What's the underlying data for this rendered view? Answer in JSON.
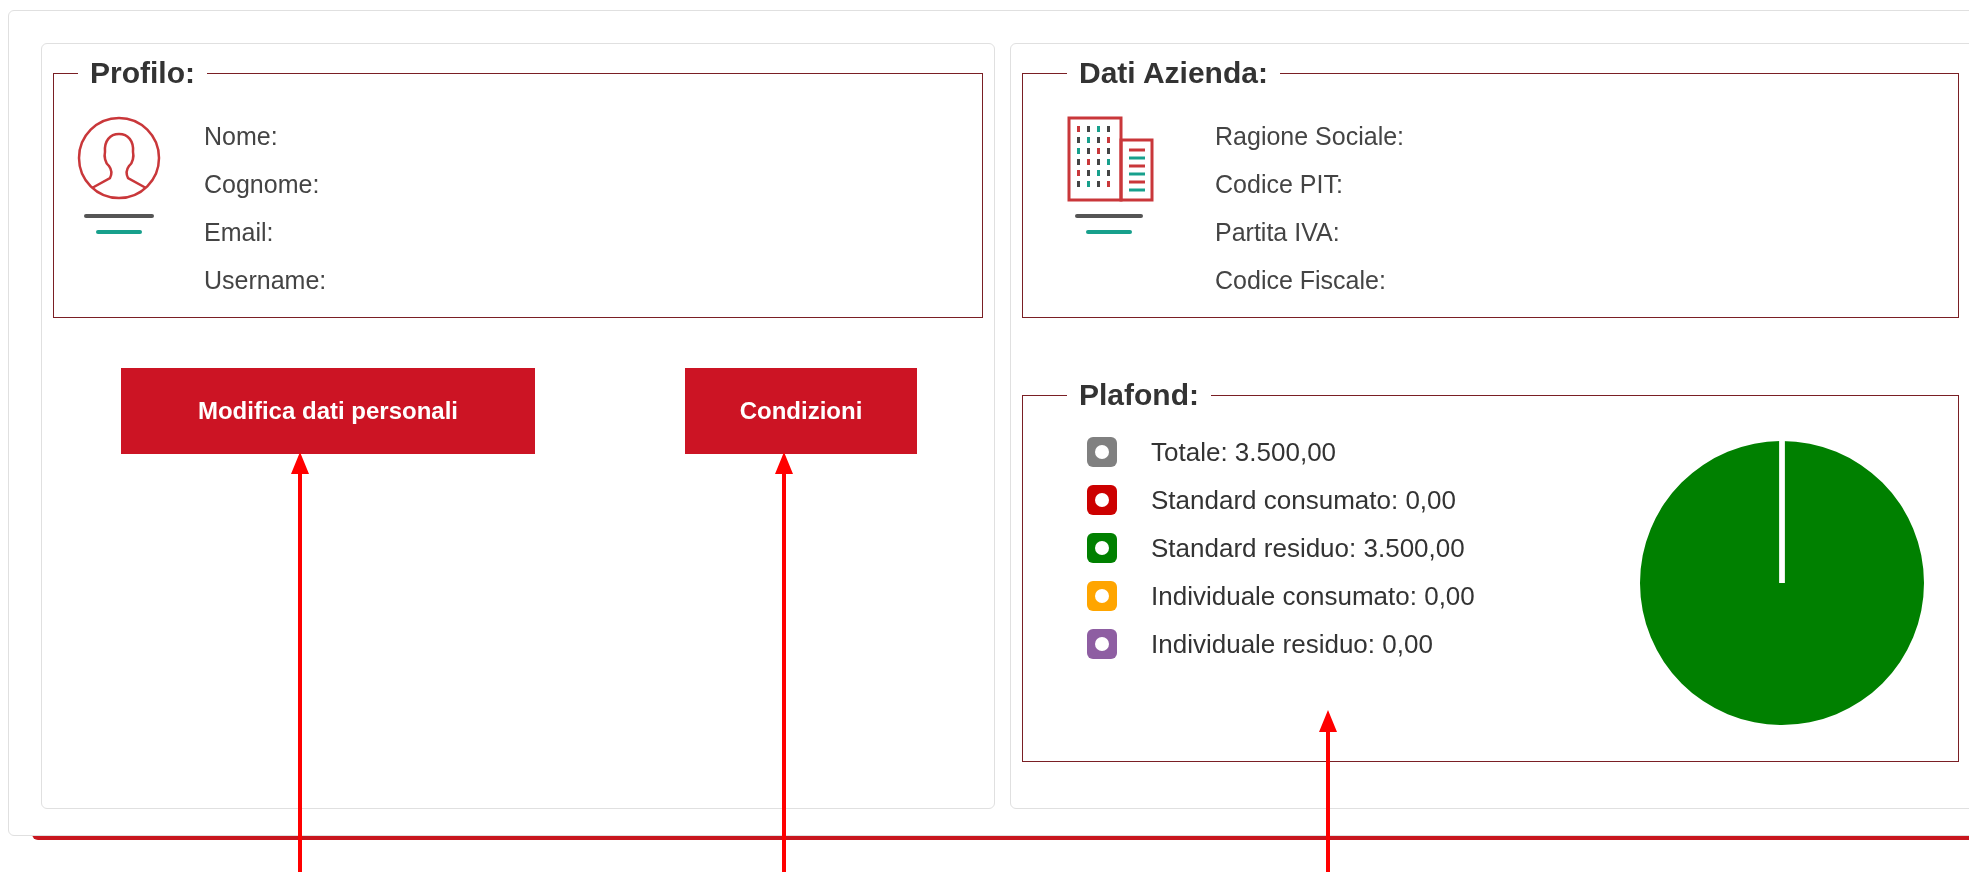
{
  "profile": {
    "title": "Profilo:",
    "fields": [
      "Nome:",
      "Cognome:",
      "Email:",
      "Username:"
    ]
  },
  "buttons": [
    "Modifica dati personali",
    "Condizioni"
  ],
  "company": {
    "title": "Dati Azienda:",
    "fields": [
      "Ragione Sociale:",
      "Codice PIT:",
      "Partita IVA:",
      "Codice Fiscale:"
    ]
  },
  "plafond": {
    "title": "Plafond:",
    "legend": [
      {
        "label": "Totale: 3.500,00",
        "color": "#808080"
      },
      {
        "label": "Standard consumato: 0,00",
        "color": "#cc0000"
      },
      {
        "label": "Standard residuo: 3.500,00",
        "color": "#008000"
      },
      {
        "label": "Individuale consumato: 0,00",
        "color": "#ffa500"
      },
      {
        "label": "Individuale residuo: 0,00",
        "color": "#8e5ea2"
      }
    ],
    "chart_data": {
      "type": "pie",
      "values": [
        0,
        100,
        0,
        0
      ]
    }
  }
}
